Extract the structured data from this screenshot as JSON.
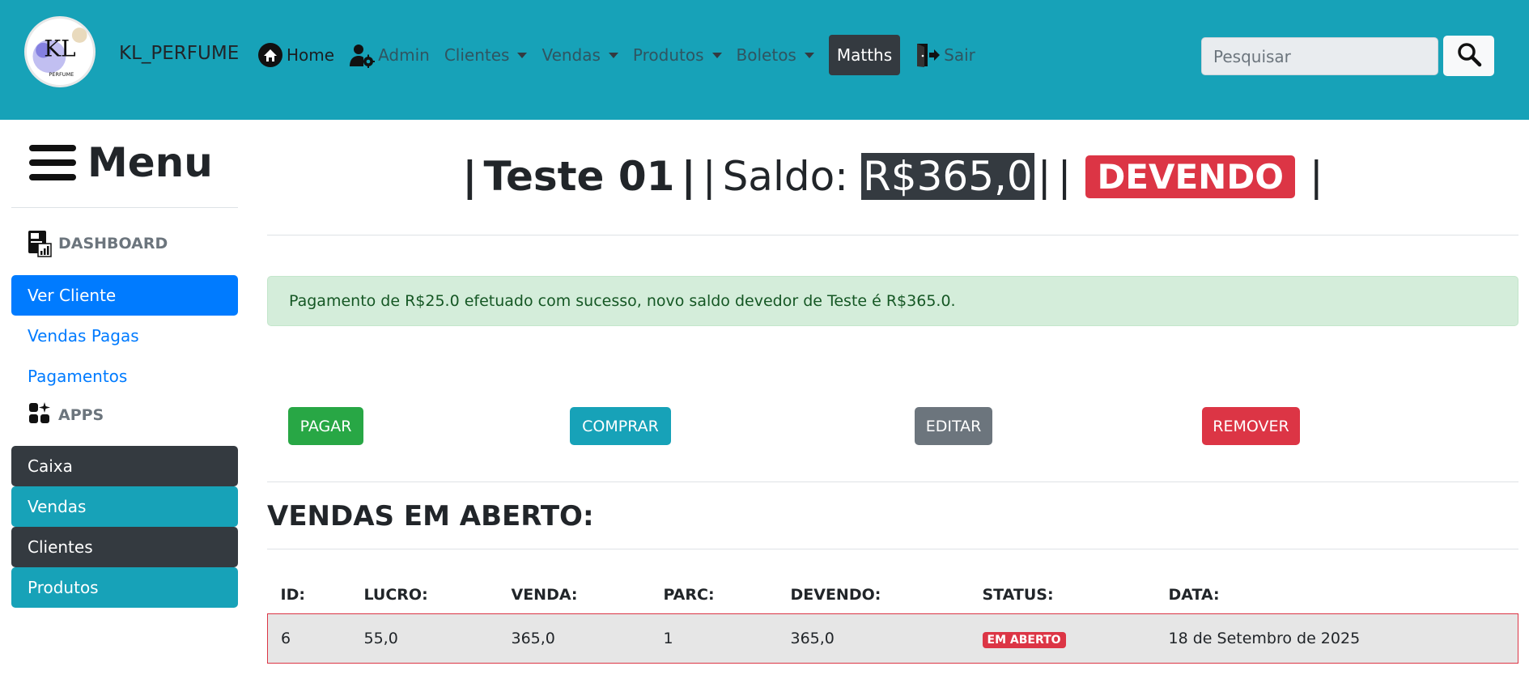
{
  "navbar": {
    "brand": "KL_PERFUME",
    "logo_text": "KL",
    "logo_subtext": "PERFUME",
    "items": [
      {
        "label": "Home",
        "icon": "home-icon"
      },
      {
        "label": "Admin",
        "icon": "admin-user-gear-icon"
      },
      {
        "label": "Clientes",
        "dropdown": true
      },
      {
        "label": "Vendas",
        "dropdown": true
      },
      {
        "label": "Produtos",
        "dropdown": true
      },
      {
        "label": "Boletos",
        "dropdown": true
      },
      {
        "label": "Matths"
      },
      {
        "label": "Sair",
        "icon": "logout-door-icon"
      }
    ],
    "search_placeholder": "Pesquisar",
    "background_color": "#17a2b8"
  },
  "sidebar": {
    "menu_title": "Menu",
    "sections": {
      "dashboard": "DASHBOARD",
      "apps": "APPS"
    },
    "dashboard_links": [
      {
        "label": "Ver Cliente",
        "active": true
      },
      {
        "label": "Vendas Pagas"
      },
      {
        "label": "Pagamentos"
      }
    ],
    "app_buttons": [
      {
        "label": "Caixa",
        "color": "#343a40"
      },
      {
        "label": "Vendas",
        "color": "#17a2b8"
      },
      {
        "label": "Clientes",
        "color": "#343a40"
      },
      {
        "label": "Produtos",
        "color": "#17a2b8"
      }
    ]
  },
  "main": {
    "title": {
      "client": "Teste 01",
      "saldo_label": "Saldo:",
      "saldo_value": "R$365,0",
      "status": "DEVENDO"
    },
    "alert_message": "Pagamento de R$25.0 efetuado com sucesso, novo saldo devedor de Teste é R$365.0.",
    "actions": [
      {
        "label": "PAGAR",
        "color": "#28a745"
      },
      {
        "label": "COMPRAR",
        "color": "#17a2b8"
      },
      {
        "label": "EDITAR",
        "color": "#6c757d"
      },
      {
        "label": "REMOVER",
        "color": "#dc3545"
      }
    ],
    "section_title": "VENDAS EM ABERTO:",
    "table": {
      "headers": [
        "ID:",
        "LUCRO:",
        "VENDA:",
        "PARC:",
        "DEVENDO:",
        "STATUS:",
        "DATA:"
      ],
      "rows": [
        {
          "id": "6",
          "lucro": "55,0",
          "venda": "365,0",
          "parc": "1",
          "devendo": "365,0",
          "status": "EM ABERTO",
          "data": "18 de Setembro de 2025"
        }
      ]
    }
  }
}
